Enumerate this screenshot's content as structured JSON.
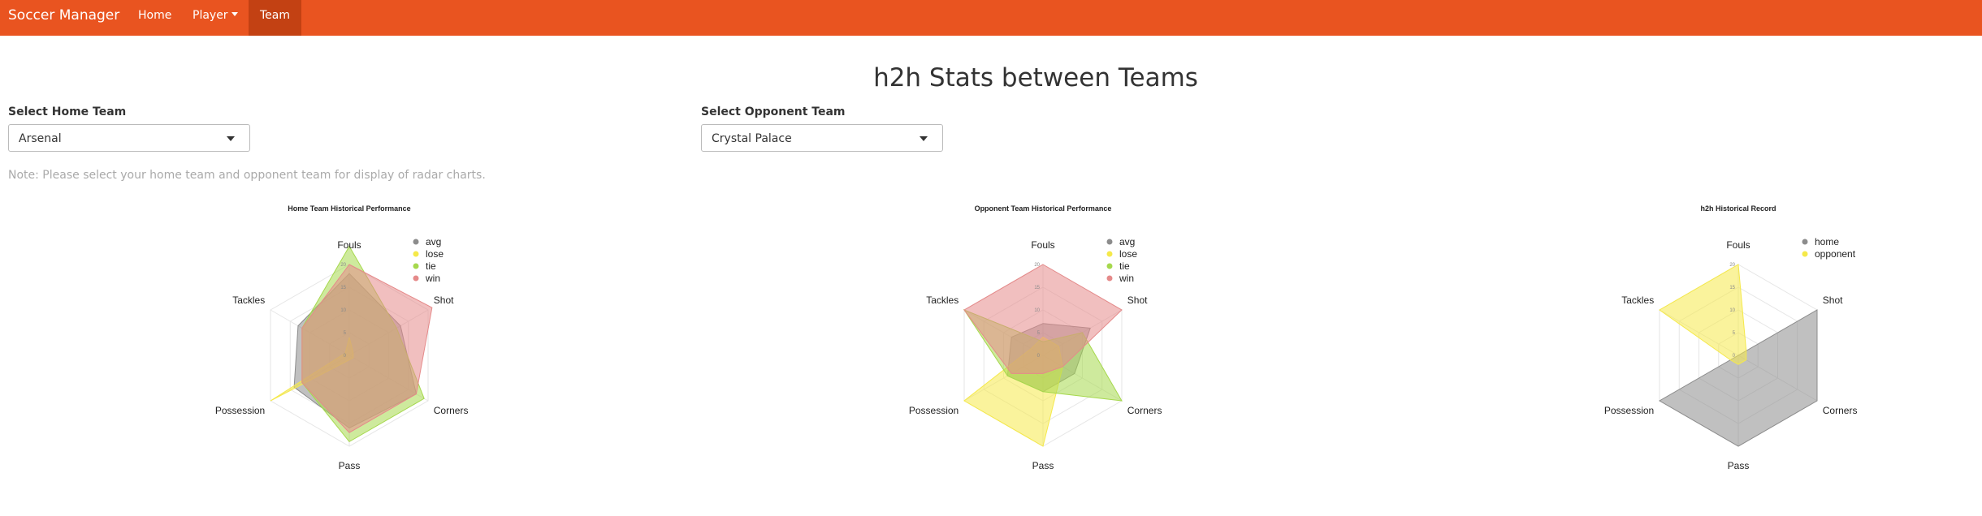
{
  "navbar": {
    "brand": "Soccer Manager",
    "items": [
      {
        "label": "Home"
      },
      {
        "label": "Player"
      },
      {
        "label": "Team"
      }
    ],
    "active": "Team",
    "color": "#e95420",
    "active_color": "#c34113"
  },
  "page": {
    "title": "h2h Stats between Teams",
    "home_label": "Select Home Team",
    "home_value": "Arsenal",
    "opponent_label": "Select Opponent Team",
    "opponent_value": "Crystal Palace",
    "note": "Note: Please select your home team and opponent team for display of radar charts."
  },
  "chart_data": [
    {
      "type": "radar",
      "title": "Home Team Historical Performance",
      "axes": [
        "Fouls",
        "Shot",
        "Corners",
        "Pass",
        "Possession",
        "Tackles"
      ],
      "range": [
        0,
        20
      ],
      "ticks": [
        "0",
        "5",
        "10",
        "15",
        "20"
      ],
      "legend_position": "top-right",
      "series": [
        {
          "name": "avg",
          "color": "#8c8c8c",
          "values": [
            18,
            13,
            17,
            16,
            14,
            13
          ]
        },
        {
          "name": "lose",
          "color": "#f5e94a",
          "values": [
            4,
            1,
            1,
            1,
            20,
            1
          ]
        },
        {
          "name": "tie",
          "color": "#a6d84d",
          "values": [
            24,
            12,
            19,
            19,
            12,
            12
          ]
        },
        {
          "name": "win",
          "color": "#e58a8a",
          "values": [
            20,
            21,
            17,
            17,
            12,
            12
          ]
        }
      ]
    },
    {
      "type": "radar",
      "title": "Opponent Team Historical Performance",
      "axes": [
        "Fouls",
        "Shot",
        "Corners",
        "Pass",
        "Possession",
        "Tackles"
      ],
      "range": [
        0,
        20
      ],
      "ticks": [
        "0",
        "5",
        "10",
        "15",
        "20"
      ],
      "legend_position": "top-right",
      "series": [
        {
          "name": "avg",
          "color": "#8c8c8c",
          "values": [
            7,
            12,
            8,
            8,
            9,
            8
          ]
        },
        {
          "name": "lose",
          "color": "#f5e94a",
          "values": [
            4,
            4,
            5,
            20,
            20,
            3
          ]
        },
        {
          "name": "tie",
          "color": "#a6d84d",
          "values": [
            3,
            10,
            20,
            8,
            9,
            20
          ]
        },
        {
          "name": "win",
          "color": "#e58a8a",
          "values": [
            20,
            20,
            5,
            4,
            8,
            20
          ]
        }
      ]
    },
    {
      "type": "radar",
      "title": "h2h Historical Record",
      "axes": [
        "Fouls",
        "Shot",
        "Corners",
        "Pass",
        "Possession",
        "Tackles"
      ],
      "range": [
        0,
        20
      ],
      "ticks": [
        "0",
        "5",
        "10",
        "15",
        "20"
      ],
      "legend_position": "top-right",
      "series": [
        {
          "name": "home",
          "color": "#8c8c8c",
          "values": [
            0,
            20,
            20,
            20,
            20,
            0
          ]
        },
        {
          "name": "opponent",
          "color": "#f5e94a",
          "values": [
            20,
            2,
            2,
            2,
            2,
            20
          ]
        }
      ]
    }
  ]
}
